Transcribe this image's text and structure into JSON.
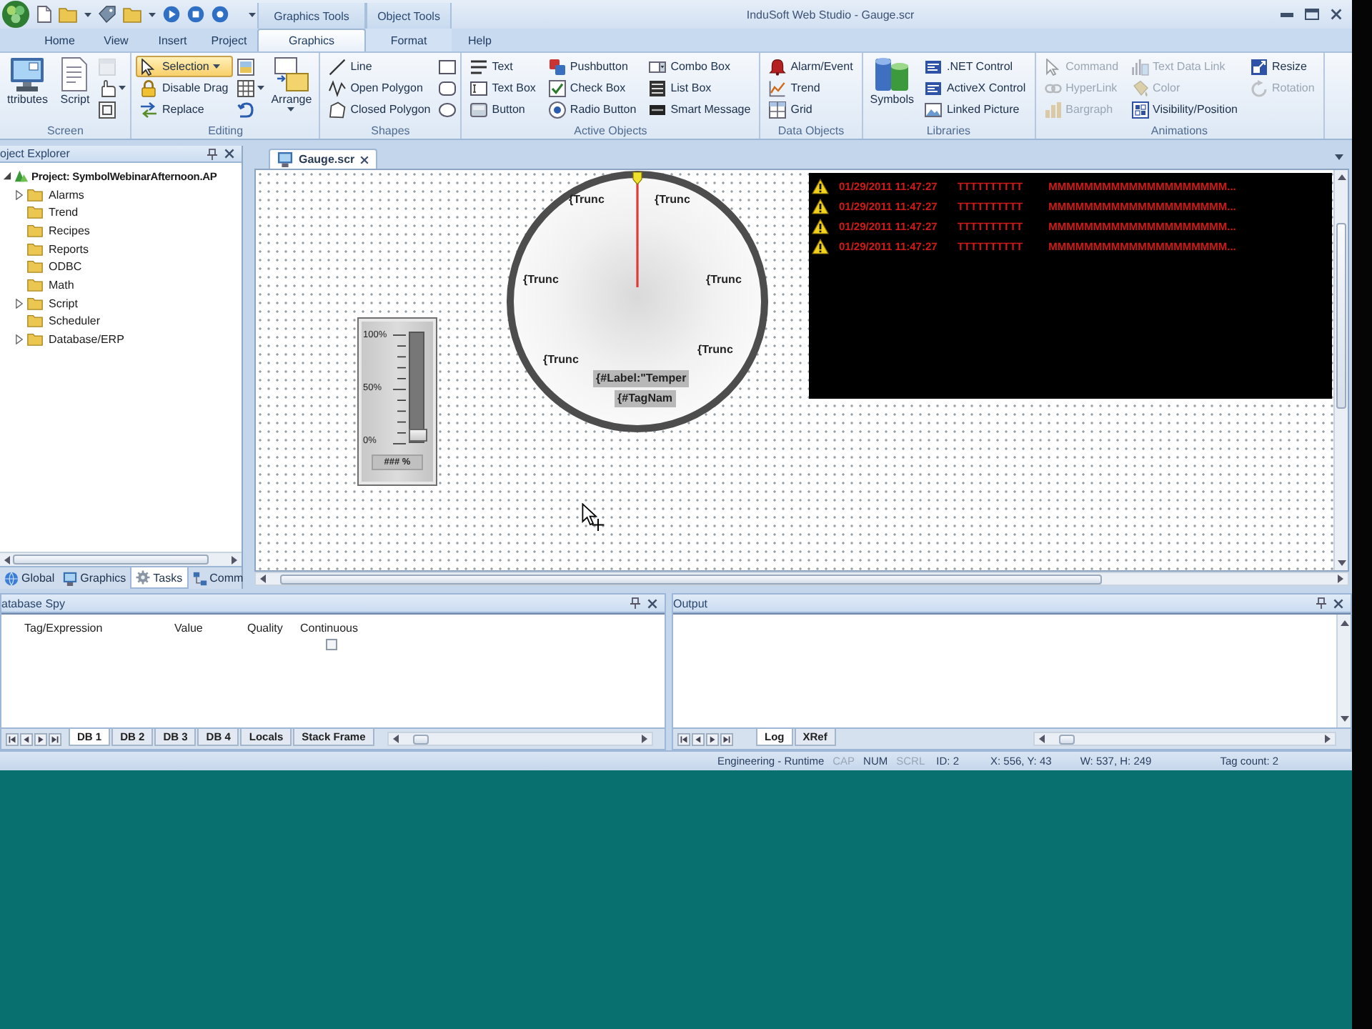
{
  "window": {
    "title": "InduSoft Web Studio - Gauge.scr"
  },
  "ribbon_tabs": [
    {
      "kind": "tab",
      "label": "Home",
      "selected": false
    },
    {
      "kind": "tab",
      "label": "View",
      "selected": false
    },
    {
      "kind": "tab",
      "label": "Insert",
      "selected": false
    },
    {
      "kind": "tab",
      "label": "Project",
      "selected": false
    },
    {
      "kind": "context",
      "label": "Graphics Tools",
      "tabs": [
        {
          "label": "Graphics",
          "selected": true
        }
      ]
    },
    {
      "kind": "context",
      "label": "Object Tools",
      "tabs": [
        {
          "label": "Format",
          "selected": false
        }
      ]
    },
    {
      "kind": "tab",
      "label": "Help",
      "selected": false
    }
  ],
  "ribbon_groups": [
    {
      "label": "Screen",
      "columns": [
        {
          "kind": "large",
          "label": "ttributes"
        },
        {
          "kind": "large",
          "label": "Script"
        },
        {
          "kind": "icons",
          "items": [
            {
              "disabled": true
            },
            {
              "disabled": false
            },
            {
              "disabled": false
            }
          ]
        }
      ]
    },
    {
      "label": "Editing",
      "columns": [
        {
          "kind": "small",
          "items": [
            {
              "label": "Selection",
              "on": true,
              "disabled": false
            },
            {
              "label": "Disable Drag",
              "on": false,
              "disabled": false
            },
            {
              "label": "Replace",
              "on": false,
              "disabled": false
            }
          ]
        },
        {
          "kind": "icons",
          "items": [
            {
              "disabled": false
            },
            {
              "disabled": false
            },
            {
              "disabled": false
            }
          ]
        },
        {
          "kind": "large",
          "label": "Arrange"
        }
      ]
    },
    {
      "label": "Shapes",
      "columns": [
        {
          "kind": "small",
          "items": [
            {
              "label": "Line",
              "disabled": false
            },
            {
              "label": "Open Polygon",
              "disabled": false
            },
            {
              "label": "Closed Polygon",
              "disabled": false
            }
          ]
        },
        {
          "kind": "icons",
          "items": [
            {
              "disabled": false
            },
            {
              "disabled": false
            },
            {
              "disabled": false
            }
          ]
        }
      ]
    },
    {
      "label": "Active Objects",
      "columns": [
        {
          "kind": "small",
          "items": [
            {
              "label": "Text",
              "disabled": false
            },
            {
              "label": "Text Box",
              "disabled": false
            },
            {
              "label": "Button",
              "disabled": false
            }
          ]
        },
        {
          "kind": "small",
          "items": [
            {
              "label": "Pushbutton",
              "disabled": false
            },
            {
              "label": "Check Box",
              "disabled": false
            },
            {
              "label": "Radio Button",
              "disabled": false
            }
          ]
        },
        {
          "kind": "small",
          "items": [
            {
              "label": "Combo Box",
              "disabled": false
            },
            {
              "label": "List Box",
              "disabled": false
            },
            {
              "label": "Smart Message",
              "disabled": false
            }
          ]
        }
      ]
    },
    {
      "label": "Data Objects",
      "columns": [
        {
          "kind": "small",
          "items": [
            {
              "label": "Alarm/Event",
              "disabled": false
            },
            {
              "label": "Trend",
              "disabled": false
            },
            {
              "label": "Grid",
              "disabled": false
            }
          ]
        }
      ]
    },
    {
      "label": "Libraries",
      "columns": [
        {
          "kind": "large",
          "label": "Symbols"
        },
        {
          "kind": "small",
          "items": [
            {
              "label": ".NET Control",
              "disabled": false
            },
            {
              "label": "ActiveX Control",
              "disabled": false
            },
            {
              "label": "Linked Picture",
              "disabled": false
            }
          ]
        }
      ]
    },
    {
      "label": "Animations",
      "columns": [
        {
          "kind": "small",
          "items": [
            {
              "label": "Command",
              "disabled": true
            },
            {
              "label": "HyperLink",
              "disabled": true
            },
            {
              "label": "Bargraph",
              "disabled": true
            }
          ]
        },
        {
          "kind": "small",
          "items": [
            {
              "label": "Text Data Link",
              "disabled": true
            },
            {
              "label": "Color",
              "disabled": true
            },
            {
              "label": "Visibility/Position",
              "disabled": false
            }
          ]
        },
        {
          "kind": "small",
          "items": [
            {
              "label": "Resize",
              "disabled": false
            },
            {
              "label": "Rotation",
              "disabled": true
            }
          ]
        }
      ]
    }
  ],
  "project_explorer": {
    "title": "oject Explorer",
    "tree": [
      {
        "label": "Project: SymbolWebinarAfternoon.AP",
        "expandable": true,
        "expanded": true,
        "children": [
          {
            "label": "Alarms",
            "expandable": true,
            "expanded": false
          },
          {
            "label": "Trend",
            "expandable": false
          },
          {
            "label": "Recipes",
            "expandable": false
          },
          {
            "label": "Reports",
            "expandable": false
          },
          {
            "label": "ODBC",
            "expandable": false
          },
          {
            "label": "Math",
            "expandable": false
          },
          {
            "label": "Script",
            "expandable": true,
            "expanded": false
          },
          {
            "label": "Scheduler",
            "expandable": false
          },
          {
            "label": "Database/ERP",
            "expandable": true,
            "expanded": false
          }
        ]
      }
    ],
    "tabs": [
      {
        "label": "Global",
        "selected": false
      },
      {
        "label": "Graphics",
        "selected": false
      },
      {
        "label": "Tasks",
        "selected": true
      },
      {
        "label": "Comm",
        "selected": false
      }
    ]
  },
  "document_tabs": [
    {
      "label": "Gauge.scr",
      "selected": true
    }
  ],
  "canvas": {
    "bargraph": {
      "scale_labels": [
        "100%",
        "50%",
        "0%"
      ],
      "level": 0,
      "readout": "### %"
    },
    "gauge": {
      "scale_labels": [
        "{Trunc",
        "{Trunc",
        "{Trunc",
        "{Trunc",
        "{Trunc",
        "{Trunc"
      ],
      "level": 0.5,
      "label": "{#Label:\"Temper",
      "tag": "{#TagNam"
    },
    "alarm_list": {
      "rows": [
        {
          "datetime": "01/29/2011 11:47:27",
          "tag": "TTTTTTTTTT",
          "message": "MMMMMMMMMMMMMMMMMMMM..."
        },
        {
          "datetime": "01/29/2011 11:47:27",
          "tag": "TTTTTTTTTT",
          "message": "MMMMMMMMMMMMMMMMMMMM..."
        },
        {
          "datetime": "01/29/2011 11:47:27",
          "tag": "TTTTTTTTTT",
          "message": "MMMMMMMMMMMMMMMMMMMM..."
        },
        {
          "datetime": "01/29/2011 11:47:27",
          "tag": "TTTTTTTTTT",
          "message": "MMMMMMMMMMMMMMMMMMMM..."
        }
      ]
    }
  },
  "database_spy": {
    "title": "atabase Spy",
    "columns": [
      "Tag/Expression",
      "Value",
      "Quality",
      "Continuous"
    ],
    "continuous_checked": false,
    "tabs": [
      {
        "label": "DB 1",
        "selected": true
      },
      {
        "label": "DB 2",
        "selected": false
      },
      {
        "label": "DB 3",
        "selected": false
      },
      {
        "label": "DB 4",
        "selected": false
      },
      {
        "label": "Locals",
        "selected": false
      },
      {
        "label": "Stack Frame",
        "selected": false
      }
    ]
  },
  "output": {
    "title": "Output",
    "tabs": [
      {
        "label": "Log",
        "selected": true
      },
      {
        "label": "XRef",
        "selected": false
      }
    ]
  },
  "status_bar": {
    "mode": "Engineering - Runtime",
    "indicators": [
      {
        "label": "CAP",
        "on": false
      },
      {
        "label": "NUM",
        "on": true
      },
      {
        "label": "SCRL",
        "on": false
      }
    ],
    "object_id": "ID: 2",
    "position": "X: 556, Y: 43",
    "size": "W: 537, H: 249",
    "tag_count": "Tag count: 2"
  }
}
